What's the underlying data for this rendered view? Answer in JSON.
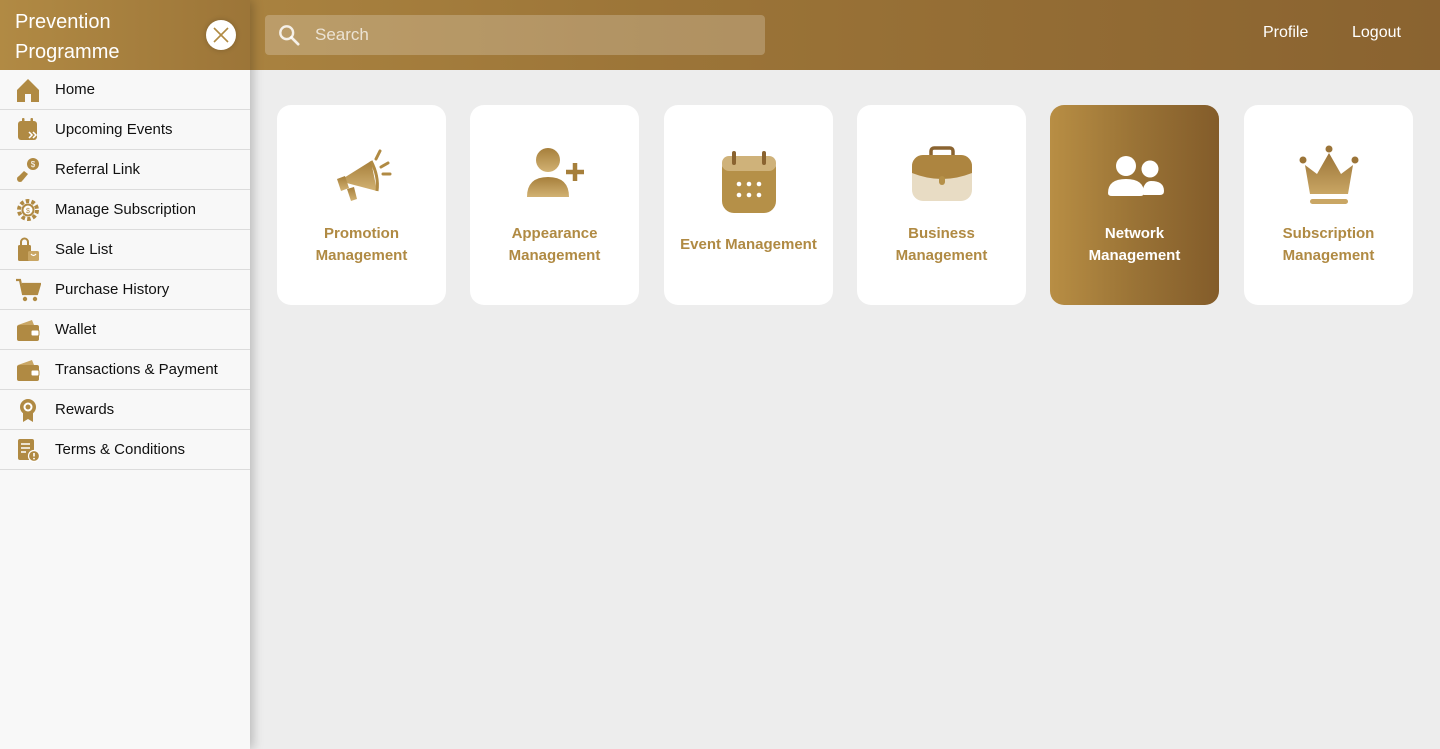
{
  "app": {
    "title": "Prevention Programme"
  },
  "search": {
    "placeholder": "Search"
  },
  "header": {
    "profile_label": "Profile",
    "logout_label": "Logout"
  },
  "sidebar": {
    "items": [
      {
        "label": "Home",
        "icon": "home-icon"
      },
      {
        "label": "Upcoming Events",
        "icon": "calendar-forward-icon"
      },
      {
        "label": "Referral Link",
        "icon": "referral-money-icon"
      },
      {
        "label": "Manage Subscription",
        "icon": "gear-dollar-icon"
      },
      {
        "label": "Sale List",
        "icon": "shopping-bag-icon"
      },
      {
        "label": "Purchase History",
        "icon": "cart-icon"
      },
      {
        "label": "Wallet",
        "icon": "wallet-icon"
      },
      {
        "label": "Transactions & Payment",
        "icon": "wallet-payment-icon"
      },
      {
        "label": "Rewards",
        "icon": "medal-icon"
      },
      {
        "label": "Terms & Conditions",
        "icon": "document-alert-icon"
      }
    ]
  },
  "cards": [
    {
      "line1": "Promotion",
      "line2": "Management",
      "icon": "megaphone-icon"
    },
    {
      "line1": "Appearance",
      "line2": "Management",
      "icon": "add-user-icon"
    },
    {
      "line1": "Event Management",
      "line2": "",
      "icon": "calendar-icon"
    },
    {
      "line1": "Business",
      "line2": "Management",
      "icon": "briefcase-icon"
    },
    {
      "line1": "Network",
      "line2": "Management",
      "icon": "users-icon",
      "active": true
    },
    {
      "line1": "Subscription",
      "line2": "Management",
      "icon": "crown-icon"
    }
  ],
  "colors": {
    "brand_gold": "#b08a43",
    "brand_dark": "#8a6330",
    "background": "#ededed"
  }
}
